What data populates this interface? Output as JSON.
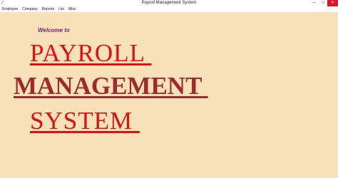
{
  "window": {
    "title": "Payroll Management System",
    "app_icon": "feather-icon",
    "controls": {
      "minimize": "─",
      "maximize": "□",
      "close": "✕"
    }
  },
  "menubar": {
    "items": [
      {
        "label": "Employee"
      },
      {
        "label": "Company"
      },
      {
        "label": "Reports"
      },
      {
        "label": "List"
      },
      {
        "label": "Misc."
      }
    ]
  },
  "main": {
    "welcome": "Welcome to",
    "line1": "PAYROLL ",
    "line2": "MANAGEMENT ",
    "line3": "SYSTEM "
  },
  "colors": {
    "background": "#f8e1b8",
    "heading_red": "#e01010",
    "heading_dark_red": "#9d2b2b",
    "welcome_purple": "#7a1f7a"
  }
}
